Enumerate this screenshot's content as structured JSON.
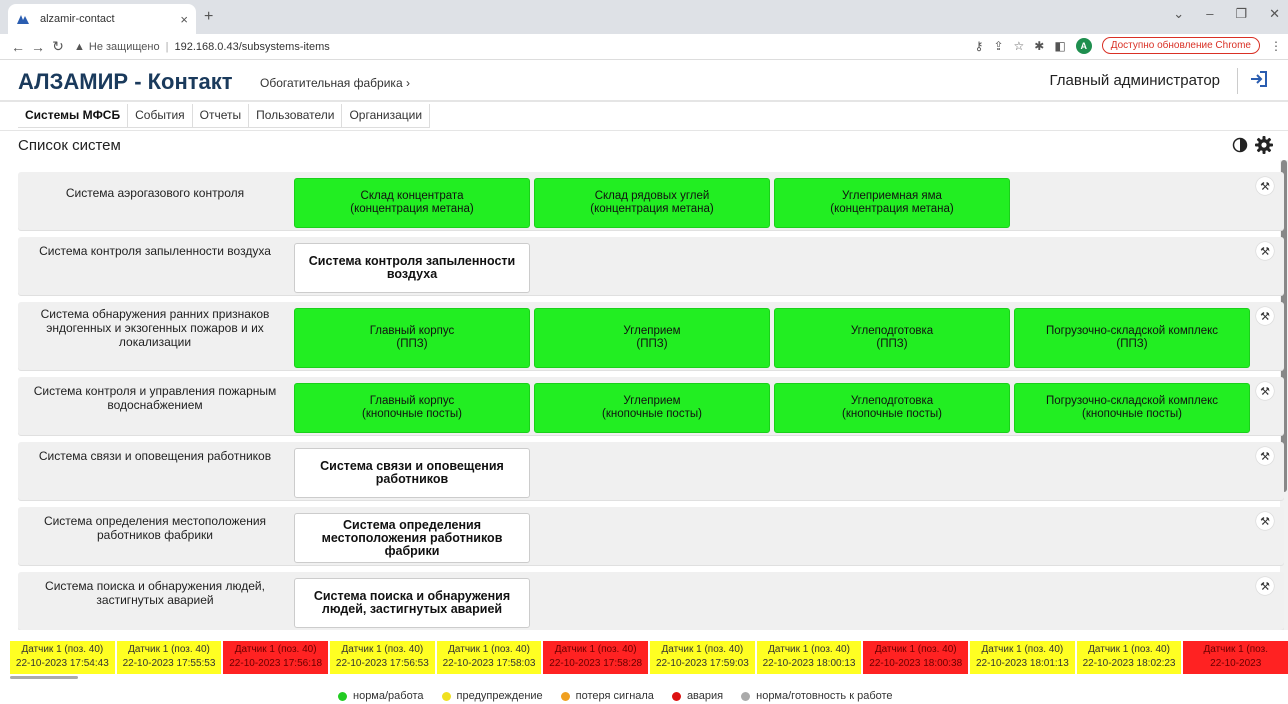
{
  "browser": {
    "tab_title": "alzamir-contact",
    "security_label": "Не защищено",
    "url": "192.168.0.43/subsystems-items",
    "update_label": "Доступно обновление Chrome",
    "avatar_letter": "A"
  },
  "header": {
    "brand": "АЛЗАМИР - Контакт",
    "plant": "Обогатительная фабрика",
    "plant_chevron": "›",
    "user": "Главный администратор"
  },
  "nav": {
    "items": [
      "Системы МФСБ",
      "События",
      "Отчеты",
      "Пользователи",
      "Организации"
    ]
  },
  "section": {
    "title": "Список систем"
  },
  "rows": [
    {
      "label": "Система аэрогазового контроля",
      "tiles": [
        {
          "style": "green",
          "line1": "Склад концентрата",
          "line2": "(концентрация метана)"
        },
        {
          "style": "green",
          "line1": "Склад рядовых углей",
          "line2": "(концентрация метана)"
        },
        {
          "style": "green",
          "line1": "Углеприемная яма",
          "line2": "(концентрация метана)"
        }
      ]
    },
    {
      "label": "Система контроля запыленности воздуха",
      "tiles": [
        {
          "style": "white",
          "line1": "Система контроля запыленности воздуха",
          "line2": ""
        }
      ]
    },
    {
      "label": "Система обнаружения ранних признаков эндогенных и экзогенных пожаров и их локализации",
      "tiles": [
        {
          "style": "green",
          "line1": "Главный корпус",
          "line2": "(ППЗ)"
        },
        {
          "style": "green",
          "line1": "Углеприем",
          "line2": "(ППЗ)"
        },
        {
          "style": "green",
          "line1": "Углеподготовка",
          "line2": "(ППЗ)"
        },
        {
          "style": "green",
          "line1": "Погрузочно-складской комплекс",
          "line2": "(ППЗ)"
        }
      ]
    },
    {
      "label": "Система контроля и управления пожарным водоснабжением",
      "tiles": [
        {
          "style": "green",
          "line1": "Главный корпус",
          "line2": "(кнопочные посты)"
        },
        {
          "style": "green",
          "line1": "Углеприем",
          "line2": "(кнопочные посты)"
        },
        {
          "style": "green",
          "line1": "Углеподготовка",
          "line2": "(кнопочные посты)"
        },
        {
          "style": "green",
          "line1": "Погрузочно-складской комплекс",
          "line2": "(кнопочные посты)"
        }
      ]
    },
    {
      "label": "Система связи и оповещения работников",
      "tiles": [
        {
          "style": "white",
          "line1": "Система связи и оповещения работников",
          "line2": ""
        }
      ]
    },
    {
      "label": "Система определения местоположения работников фабрики",
      "tiles": [
        {
          "style": "white",
          "line1": "Система определения местоположения работников фабрики",
          "line2": ""
        }
      ]
    },
    {
      "label": "Система поиска и обнаружения людей, застигнутых аварией",
      "tiles": [
        {
          "style": "white",
          "line1": "Система поиска и обнаружения людей, застигнутых аварией",
          "line2": ""
        }
      ]
    }
  ],
  "sensors": [
    {
      "status": "yellow",
      "name": "Датчик 1 (поз. 40)",
      "time": "22-10-2023 17:54:43"
    },
    {
      "status": "yellow",
      "name": "Датчик 1 (поз. 40)",
      "time": "22-10-2023 17:55:53"
    },
    {
      "status": "red",
      "name": "Датчик 1 (поз. 40)",
      "time": "22-10-2023 17:56:18"
    },
    {
      "status": "yellow",
      "name": "Датчик 1 (поз. 40)",
      "time": "22-10-2023 17:56:53"
    },
    {
      "status": "yellow",
      "name": "Датчик 1 (поз. 40)",
      "time": "22-10-2023 17:58:03"
    },
    {
      "status": "red",
      "name": "Датчик 1 (поз. 40)",
      "time": "22-10-2023 17:58:28"
    },
    {
      "status": "yellow",
      "name": "Датчик 1 (поз. 40)",
      "time": "22-10-2023 17:59:03"
    },
    {
      "status": "yellow",
      "name": "Датчик 1 (поз. 40)",
      "time": "22-10-2023 18:00:13"
    },
    {
      "status": "red",
      "name": "Датчик 1 (поз. 40)",
      "time": "22-10-2023 18:00:38"
    },
    {
      "status": "yellow",
      "name": "Датчик 1 (поз. 40)",
      "time": "22-10-2023 18:01:13"
    },
    {
      "status": "yellow",
      "name": "Датчик 1 (поз. 40)",
      "time": "22-10-2023 18:02:23"
    },
    {
      "status": "red",
      "name": "Датчик 1 (поз.",
      "time": "22-10-2023"
    }
  ],
  "legend": [
    {
      "color": "#22cc22",
      "label": "норма/работа"
    },
    {
      "color": "#f0e020",
      "label": "предупреждение"
    },
    {
      "color": "#f0a020",
      "label": "потеря сигнала"
    },
    {
      "color": "#dd1111",
      "label": "авария"
    },
    {
      "color": "#aaaaaa",
      "label": "норма/готовность к работе"
    }
  ],
  "colors": {
    "brand": "#1a3a5c",
    "tile_green": "#22ee22",
    "sensor_yellow": "#ffff22",
    "sensor_red": "#ff2222"
  }
}
